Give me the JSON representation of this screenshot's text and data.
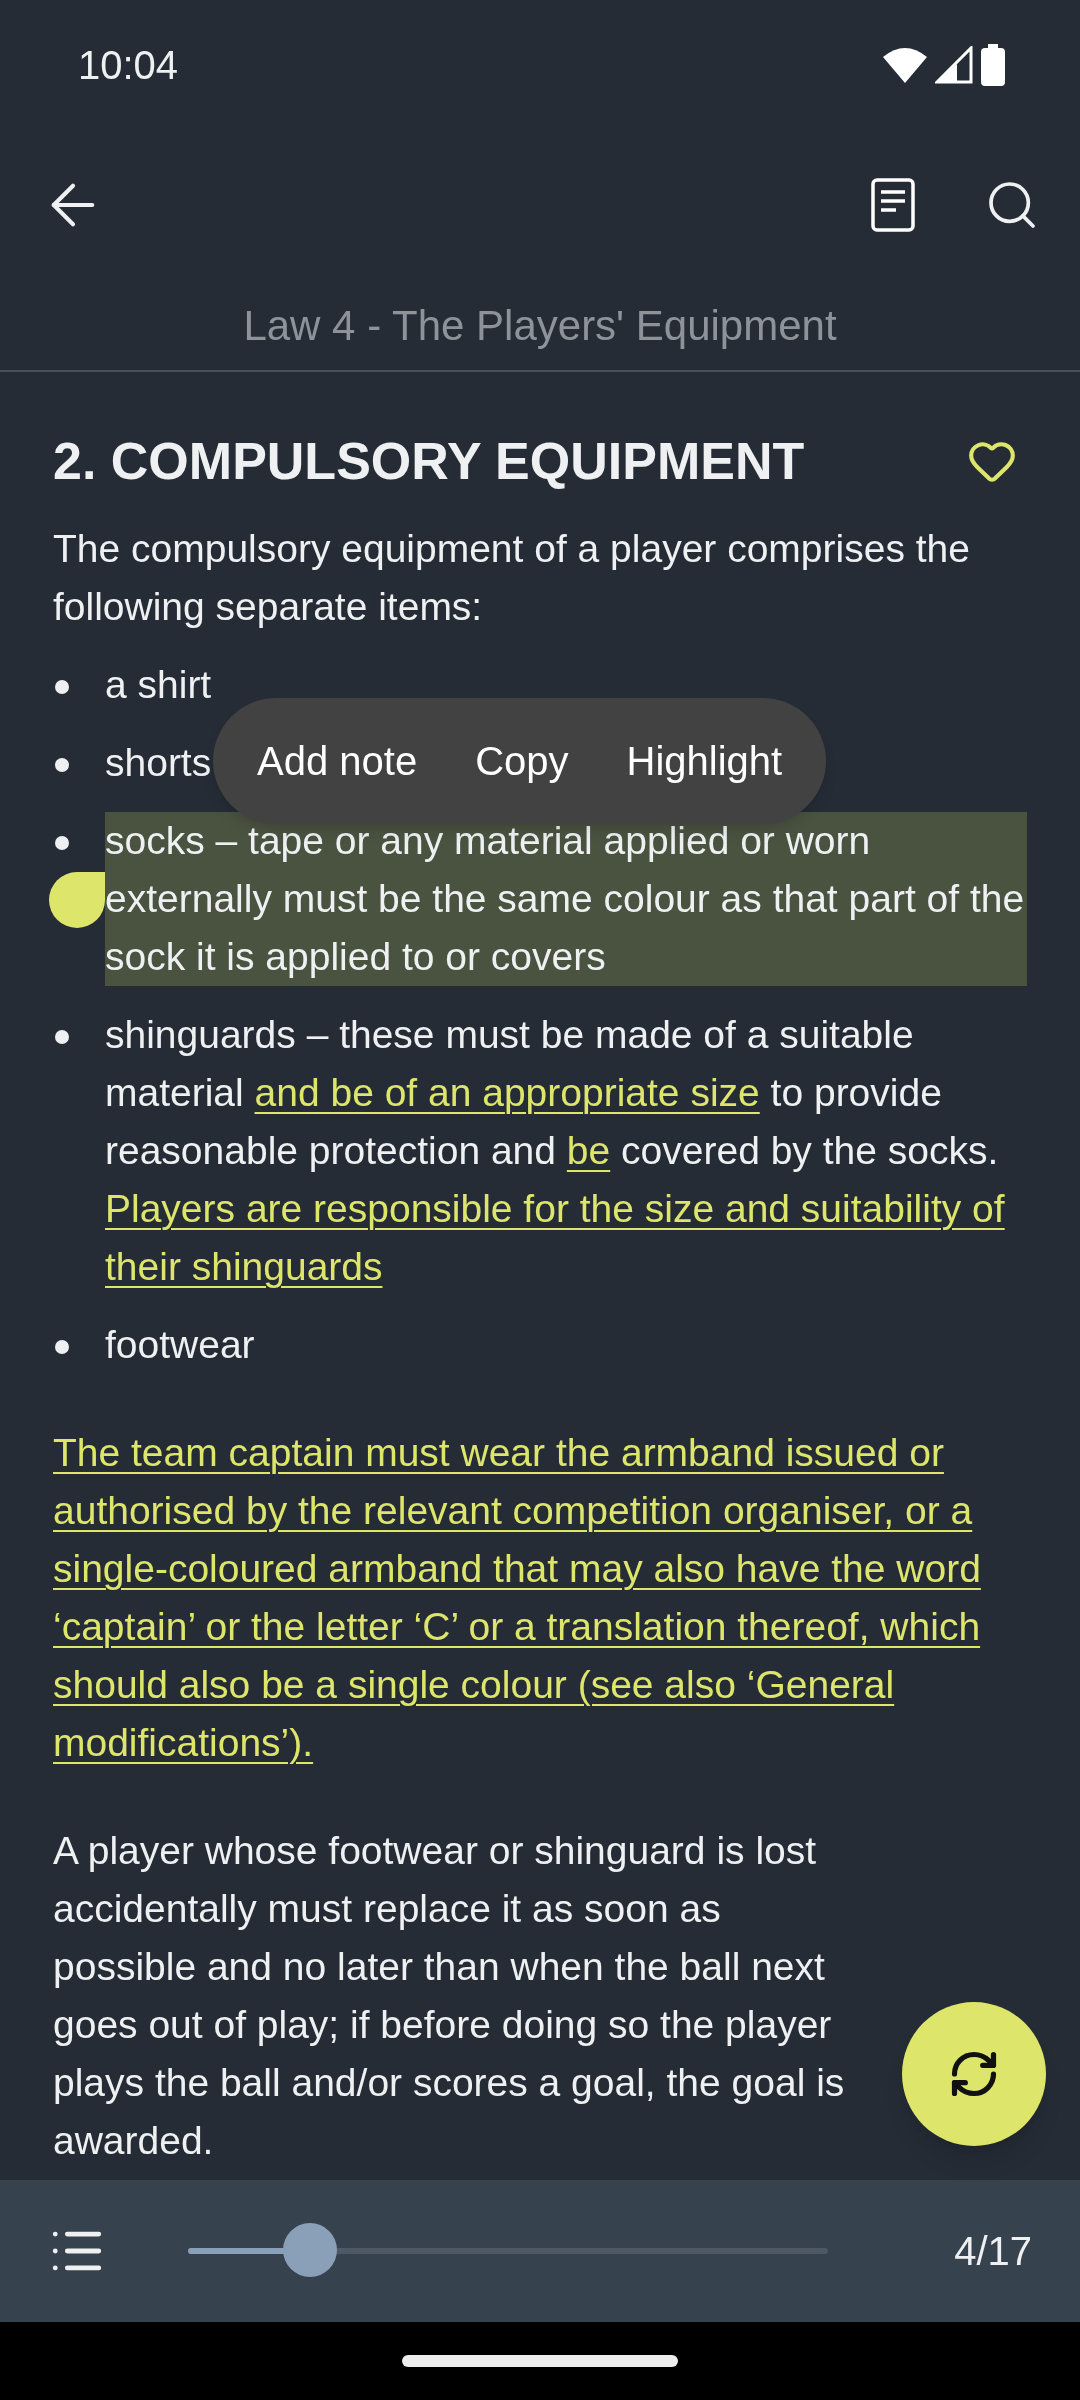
{
  "status_bar": {
    "time": "10:04"
  },
  "header": {
    "title": "Law 4 - The Players' Equipment"
  },
  "section": {
    "heading": "2. COMPULSORY EQUIPMENT",
    "favorite": false
  },
  "intro": "The compulsory equipment of a player comprises the following separate items:",
  "items": [
    {
      "selected": false,
      "segments": [
        {
          "text": "a shirt",
          "highlighted": false
        }
      ]
    },
    {
      "selected": false,
      "segments": [
        {
          "text": "shorts",
          "highlighted": false
        }
      ]
    },
    {
      "selected": true,
      "segments": [
        {
          "text": "socks – tape or any material applied or worn externally must be the same colour as that part of the sock it is applied to or covers",
          "highlighted": false
        }
      ]
    },
    {
      "selected": false,
      "segments": [
        {
          "text": "shinguards – these must be made of a suitable material ",
          "highlighted": false
        },
        {
          "text": "and be of an appropriate size",
          "highlighted": true
        },
        {
          "text": " to provide reasonable protection and ",
          "highlighted": false
        },
        {
          "text": "be",
          "highlighted": true
        },
        {
          "text": " covered by the socks. ",
          "highlighted": false
        },
        {
          "text": "Players are responsible for the size and suitability of their shinguards",
          "highlighted": true
        }
      ]
    },
    {
      "selected": false,
      "segments": [
        {
          "text": "footwear",
          "highlighted": false
        }
      ]
    }
  ],
  "paragraphs": [
    {
      "segments": [
        {
          "text": "The team captain must wear the armband issued or authorised by the relevant competition organiser, or a single-coloured armband that may also have the word ‘captain’ or the letter ‘C’ or a translation thereof, which should also be a single colour (see also ‘General modifications’).",
          "highlighted": true
        }
      ]
    },
    {
      "segments": [
        {
          "text": "A player whose footwear or shinguard is lost accidentally must replace it as soon as possible and no later than when the ball next goes out of play; if before doing so the player plays the ball and/or scores a goal, the goal is awarded.",
          "highlighted": false
        }
      ]
    }
  ],
  "context_menu": [
    "Add note",
    "Copy",
    "Highlight"
  ],
  "bottom_bar": {
    "progress": {
      "level": 0.19
    },
    "page": "4/17"
  }
}
